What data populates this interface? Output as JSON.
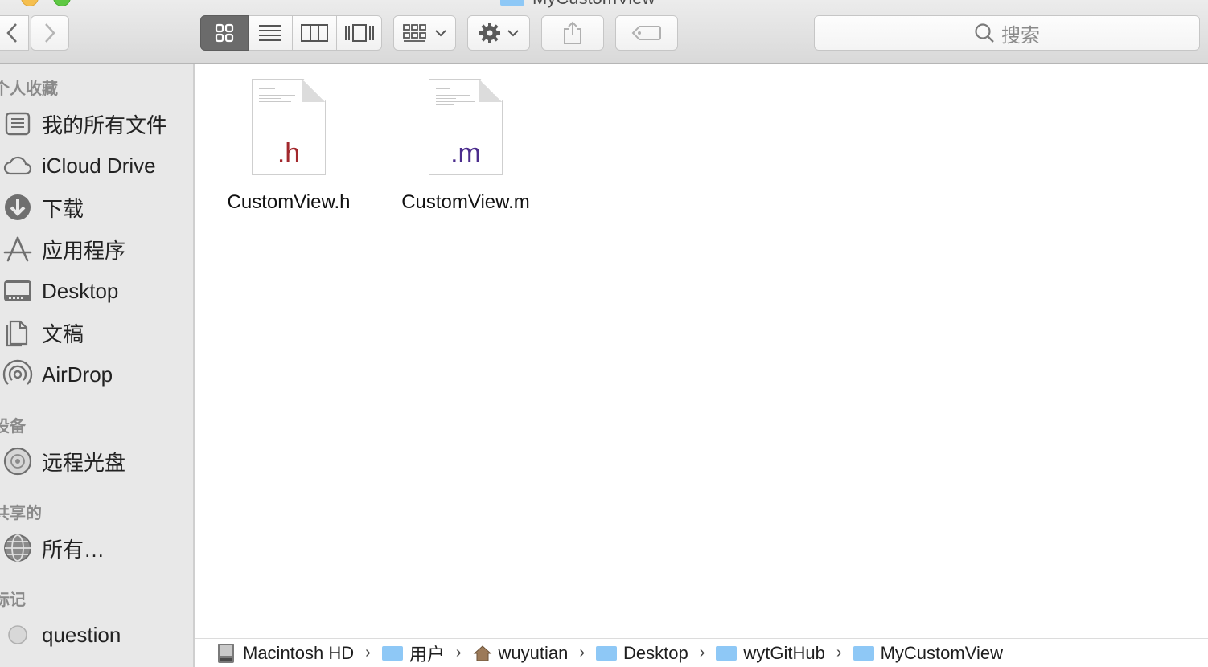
{
  "window": {
    "title": "MyCustomView"
  },
  "toolbar": {
    "back_icon": "chevron-left-icon",
    "forward_icon": "chevron-right-icon",
    "view_modes": [
      "icon-view",
      "list-view",
      "column-view",
      "cover-flow-view"
    ],
    "active_view": "icon-view",
    "search_placeholder": "搜索"
  },
  "sidebar": {
    "favorites_header": "个人收藏",
    "favorites": [
      {
        "label": "我的所有文件",
        "icon": "all-files-icon"
      },
      {
        "label": "iCloud Drive",
        "icon": "cloud-icon"
      },
      {
        "label": "下载",
        "icon": "download-icon"
      },
      {
        "label": "应用程序",
        "icon": "applications-icon"
      },
      {
        "label": "Desktop",
        "icon": "desktop-icon"
      },
      {
        "label": "文稿",
        "icon": "documents-icon"
      },
      {
        "label": "AirDrop",
        "icon": "airdrop-icon"
      }
    ],
    "devices_header": "设备",
    "devices": [
      {
        "label": "远程光盘",
        "icon": "disc-icon"
      }
    ],
    "shared_header": "共享的",
    "shared": [
      {
        "label": "所有…",
        "icon": "network-icon"
      }
    ],
    "tags_header": "标记",
    "tags": [
      {
        "label": "question",
        "icon": "tag-circle-icon"
      }
    ]
  },
  "files": [
    {
      "name": "CustomView.h",
      "ext": ".h",
      "ext_color": "#a2282d"
    },
    {
      "name": "CustomView.m",
      "ext": ".m",
      "ext_color": "#4b2c8d"
    }
  ],
  "pathbar": {
    "crumbs": [
      "Macintosh HD",
      "用户",
      "wuyutian",
      "Desktop",
      "wytGitHub",
      "MyCustomView"
    ]
  }
}
